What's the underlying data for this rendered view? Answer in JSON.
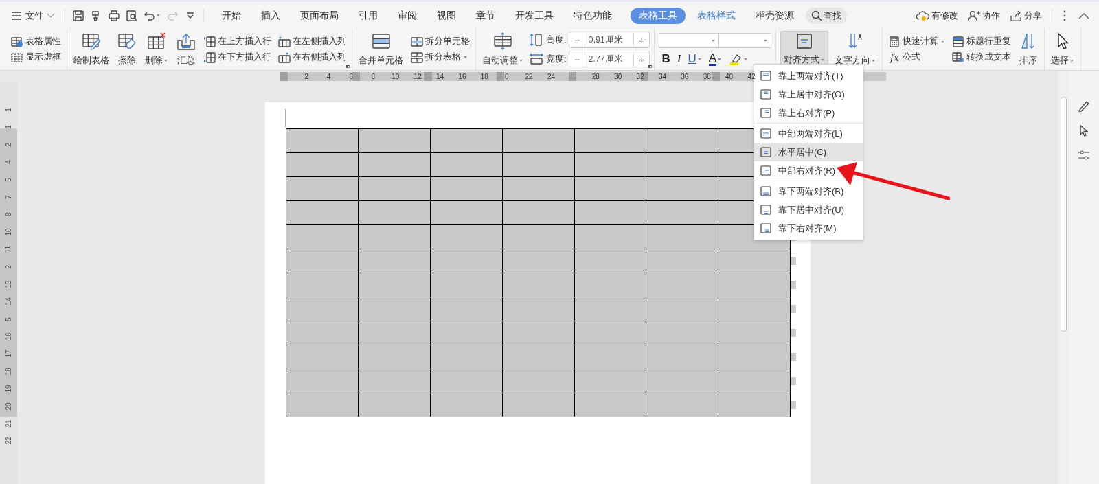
{
  "top_bar": {
    "file_menu": "文件",
    "quick_access": [
      {
        "kind": "save",
        "disabled": false
      },
      {
        "kind": "format-painter",
        "disabled": false
      },
      {
        "kind": "print",
        "disabled": false
      },
      {
        "kind": "preview",
        "disabled": false
      },
      {
        "kind": "undo",
        "disabled": false
      },
      {
        "kind": "redo",
        "disabled": true
      },
      {
        "kind": "customize",
        "disabled": false
      }
    ],
    "tabs": [
      {
        "label": "开始",
        "selected": false,
        "contextual": false
      },
      {
        "label": "插入",
        "selected": false,
        "contextual": false
      },
      {
        "label": "页面布局",
        "selected": false,
        "contextual": false
      },
      {
        "label": "引用",
        "selected": false,
        "contextual": false
      },
      {
        "label": "审阅",
        "selected": false,
        "contextual": false
      },
      {
        "label": "视图",
        "selected": false,
        "contextual": false
      },
      {
        "label": "章节",
        "selected": false,
        "contextual": false
      },
      {
        "label": "开发工具",
        "selected": false,
        "contextual": false
      },
      {
        "label": "特色功能",
        "selected": false,
        "contextual": false
      },
      {
        "label": "表格工具",
        "selected": true,
        "contextual": true
      },
      {
        "label": "表格样式",
        "selected": false,
        "contextual": true
      },
      {
        "label": "稻壳资源",
        "selected": false,
        "contextual": false
      }
    ],
    "search": "查找",
    "actions": [
      {
        "kind": "cloud",
        "label": "有修改"
      },
      {
        "kind": "collab",
        "label": "协作"
      },
      {
        "kind": "share",
        "label": "分享"
      }
    ]
  },
  "ribbon": [
    {
      "launcher": false,
      "items": [
        {
          "kind": "stack",
          "items": [
            {
              "label": "表格属性",
              "dropdown": false
            },
            {
              "label": "显示虚框",
              "dropdown": false
            }
          ]
        }
      ]
    },
    {
      "launcher": true,
      "items": [
        {
          "kind": "large",
          "label": "绘制表格",
          "dropdown": false
        },
        {
          "kind": "large",
          "label": "擦除",
          "dropdown": false
        },
        {
          "kind": "large",
          "label": "删除",
          "dropdown": true
        },
        {
          "kind": "large",
          "label": "汇总",
          "dropdown": false
        },
        {
          "kind": "stack",
          "items": [
            {
              "label": "在上方插入行",
              "dropdown": false
            },
            {
              "label": "在下方插入行",
              "dropdown": false
            }
          ]
        },
        {
          "kind": "stack",
          "items": [
            {
              "label": "在左侧插入列",
              "dropdown": false
            },
            {
              "label": "在右侧插入列",
              "dropdown": false
            }
          ]
        }
      ]
    },
    {
      "launcher": false,
      "items": [
        {
          "kind": "large",
          "label": "合并单元格",
          "dropdown": false
        },
        {
          "kind": "stack",
          "items": [
            {
              "label": "拆分单元格",
              "dropdown": false
            },
            {
              "label": "拆分表格",
              "dropdown": true
            }
          ]
        }
      ]
    },
    {
      "launcher": true,
      "items": [
        {
          "kind": "large",
          "label": "自动调整",
          "dropdown": true
        },
        {
          "kind": "spinners",
          "items": [
            {
              "label": "高度:",
              "value": "0.91厘米",
              "minus": "−",
              "plus": "+"
            },
            {
              "label": "宽度:",
              "value": "2.77厘米",
              "minus": "−",
              "plus": "+"
            }
          ]
        }
      ]
    },
    {
      "launcher": false,
      "items": [
        {
          "kind": "font",
          "buttons": [
            {
              "kind": "bold",
              "label": "B",
              "dropdown": false
            },
            {
              "kind": "italic",
              "label": "I",
              "dropdown": false
            },
            {
              "kind": "underline",
              "label": "U",
              "dropdown": true
            },
            {
              "kind": "font-color",
              "label": "A",
              "dropdown": true
            },
            {
              "kind": "highlight",
              "dropdown": true
            }
          ]
        }
      ]
    },
    {
      "launcher": false,
      "items": [
        {
          "kind": "large",
          "label": "对齐方式",
          "dropdown": true,
          "pressed": true
        },
        {
          "kind": "large",
          "label": "文字方向",
          "dropdown": true,
          "pressed": false
        }
      ]
    },
    {
      "launcher": false,
      "items": [
        {
          "kind": "stack",
          "items": [
            {
              "label": "快速计算",
              "dropdown": true
            },
            {
              "label": "公式",
              "dropdown": false,
              "icon_text": "fx"
            }
          ]
        },
        {
          "kind": "stack",
          "items": [
            {
              "label": "标题行重复",
              "dropdown": false
            },
            {
              "label": "转换成文本",
              "dropdown": false
            }
          ]
        },
        {
          "kind": "large",
          "label": "排序",
          "dropdown": false
        }
      ]
    },
    {
      "launcher": false,
      "items": [
        {
          "kind": "large",
          "label": "选择",
          "dropdown": true
        }
      ]
    }
  ],
  "horizontal_ruler": [
    {
      "kind": "number",
      "label": "2"
    },
    {
      "kind": "number",
      "label": "4"
    },
    {
      "kind": "number",
      "label": "6"
    },
    {
      "kind": "number",
      "label": "8"
    },
    {
      "kind": "number",
      "label": "10"
    },
    {
      "kind": "number",
      "label": "12"
    },
    {
      "kind": "number",
      "label": "14"
    },
    {
      "kind": "number",
      "label": "16"
    },
    {
      "kind": "number",
      "label": "18"
    },
    {
      "kind": "number",
      "label": "0"
    },
    {
      "kind": "number",
      "label": "22"
    },
    {
      "kind": "number",
      "label": "24"
    },
    {
      "kind": "covered"
    },
    {
      "kind": "number",
      "label": "28"
    },
    {
      "kind": "number",
      "label": "30"
    },
    {
      "kind": "number",
      "label": "32"
    },
    {
      "kind": "number",
      "label": "34"
    },
    {
      "kind": "number",
      "label": "36"
    },
    {
      "kind": "number",
      "label": "38"
    },
    {
      "kind": "number",
      "label": "40"
    },
    {
      "kind": "number",
      "label": "42"
    }
  ],
  "vertical_ruler": [
    "1",
    "1",
    "2",
    "4",
    "5",
    "7",
    "8",
    "10",
    "11",
    "2",
    "13",
    "14",
    "5",
    "16",
    "17",
    "18",
    "19",
    "20",
    "21",
    "22"
  ],
  "table": {
    "rows": [
      {
        "cells": [
          {
            "selected": true
          },
          {
            "selected": true
          },
          {
            "selected": true
          },
          {
            "selected": true
          },
          {
            "selected": true
          },
          {
            "selected": true
          },
          {
            "selected": true
          }
        ]
      },
      {
        "cells": [
          {
            "selected": true
          },
          {
            "selected": true
          },
          {
            "selected": true
          },
          {
            "selected": true
          },
          {
            "selected": true
          },
          {
            "selected": true
          },
          {
            "selected": true
          }
        ]
      },
      {
        "cells": [
          {
            "selected": true
          },
          {
            "selected": true
          },
          {
            "selected": true
          },
          {
            "selected": true
          },
          {
            "selected": true
          },
          {
            "selected": true
          },
          {
            "selected": true
          }
        ]
      },
      {
        "cells": [
          {
            "selected": true
          },
          {
            "selected": true
          },
          {
            "selected": true
          },
          {
            "selected": true
          },
          {
            "selected": true
          },
          {
            "selected": true
          },
          {
            "selected": true
          }
        ]
      },
      {
        "cells": [
          {
            "selected": true
          },
          {
            "selected": true
          },
          {
            "selected": true
          },
          {
            "selected": true
          },
          {
            "selected": true
          },
          {
            "selected": true
          },
          {
            "selected": true
          }
        ]
      },
      {
        "cells": [
          {
            "selected": true
          },
          {
            "selected": true
          },
          {
            "selected": true
          },
          {
            "selected": true
          },
          {
            "selected": true
          },
          {
            "selected": true
          },
          {
            "selected": true
          }
        ]
      },
      {
        "cells": [
          {
            "selected": true
          },
          {
            "selected": true
          },
          {
            "selected": true
          },
          {
            "selected": true
          },
          {
            "selected": true
          },
          {
            "selected": true
          },
          {
            "selected": true
          }
        ]
      },
      {
        "cells": [
          {
            "selected": true
          },
          {
            "selected": true
          },
          {
            "selected": true
          },
          {
            "selected": true
          },
          {
            "selected": true
          },
          {
            "selected": true
          },
          {
            "selected": true
          }
        ]
      },
      {
        "cells": [
          {
            "selected": true
          },
          {
            "selected": true
          },
          {
            "selected": true
          },
          {
            "selected": true
          },
          {
            "selected": true
          },
          {
            "selected": true
          },
          {
            "selected": true
          }
        ]
      },
      {
        "cells": [
          {
            "selected": true
          },
          {
            "selected": true
          },
          {
            "selected": true
          },
          {
            "selected": true
          },
          {
            "selected": true
          },
          {
            "selected": true
          },
          {
            "selected": true
          }
        ]
      },
      {
        "cells": [
          {
            "selected": true
          },
          {
            "selected": true
          },
          {
            "selected": true
          },
          {
            "selected": true
          },
          {
            "selected": true
          },
          {
            "selected": true
          },
          {
            "selected": true
          }
        ]
      },
      {
        "cells": [
          {
            "selected": true
          },
          {
            "selected": true
          },
          {
            "selected": true
          },
          {
            "selected": true
          },
          {
            "selected": true
          },
          {
            "selected": true
          },
          {
            "selected": true
          }
        ]
      }
    ]
  },
  "align_menu": {
    "groups": [
      [
        {
          "label": "靠上两端对齐(T)",
          "selected": false
        },
        {
          "label": "靠上居中对齐(O)",
          "selected": false
        },
        {
          "label": "靠上右对齐(P)",
          "selected": false
        }
      ],
      [
        {
          "label": "中部两端对齐(L)",
          "selected": false
        },
        {
          "label": "水平居中(C)",
          "selected": true
        },
        {
          "label": "中部右对齐(R)",
          "selected": false
        }
      ],
      [
        {
          "label": "靠下两端对齐(B)",
          "selected": false
        },
        {
          "label": "靠下居中对齐(U)",
          "selected": false
        },
        {
          "label": "靠下右对齐(M)",
          "selected": false
        }
      ]
    ]
  }
}
